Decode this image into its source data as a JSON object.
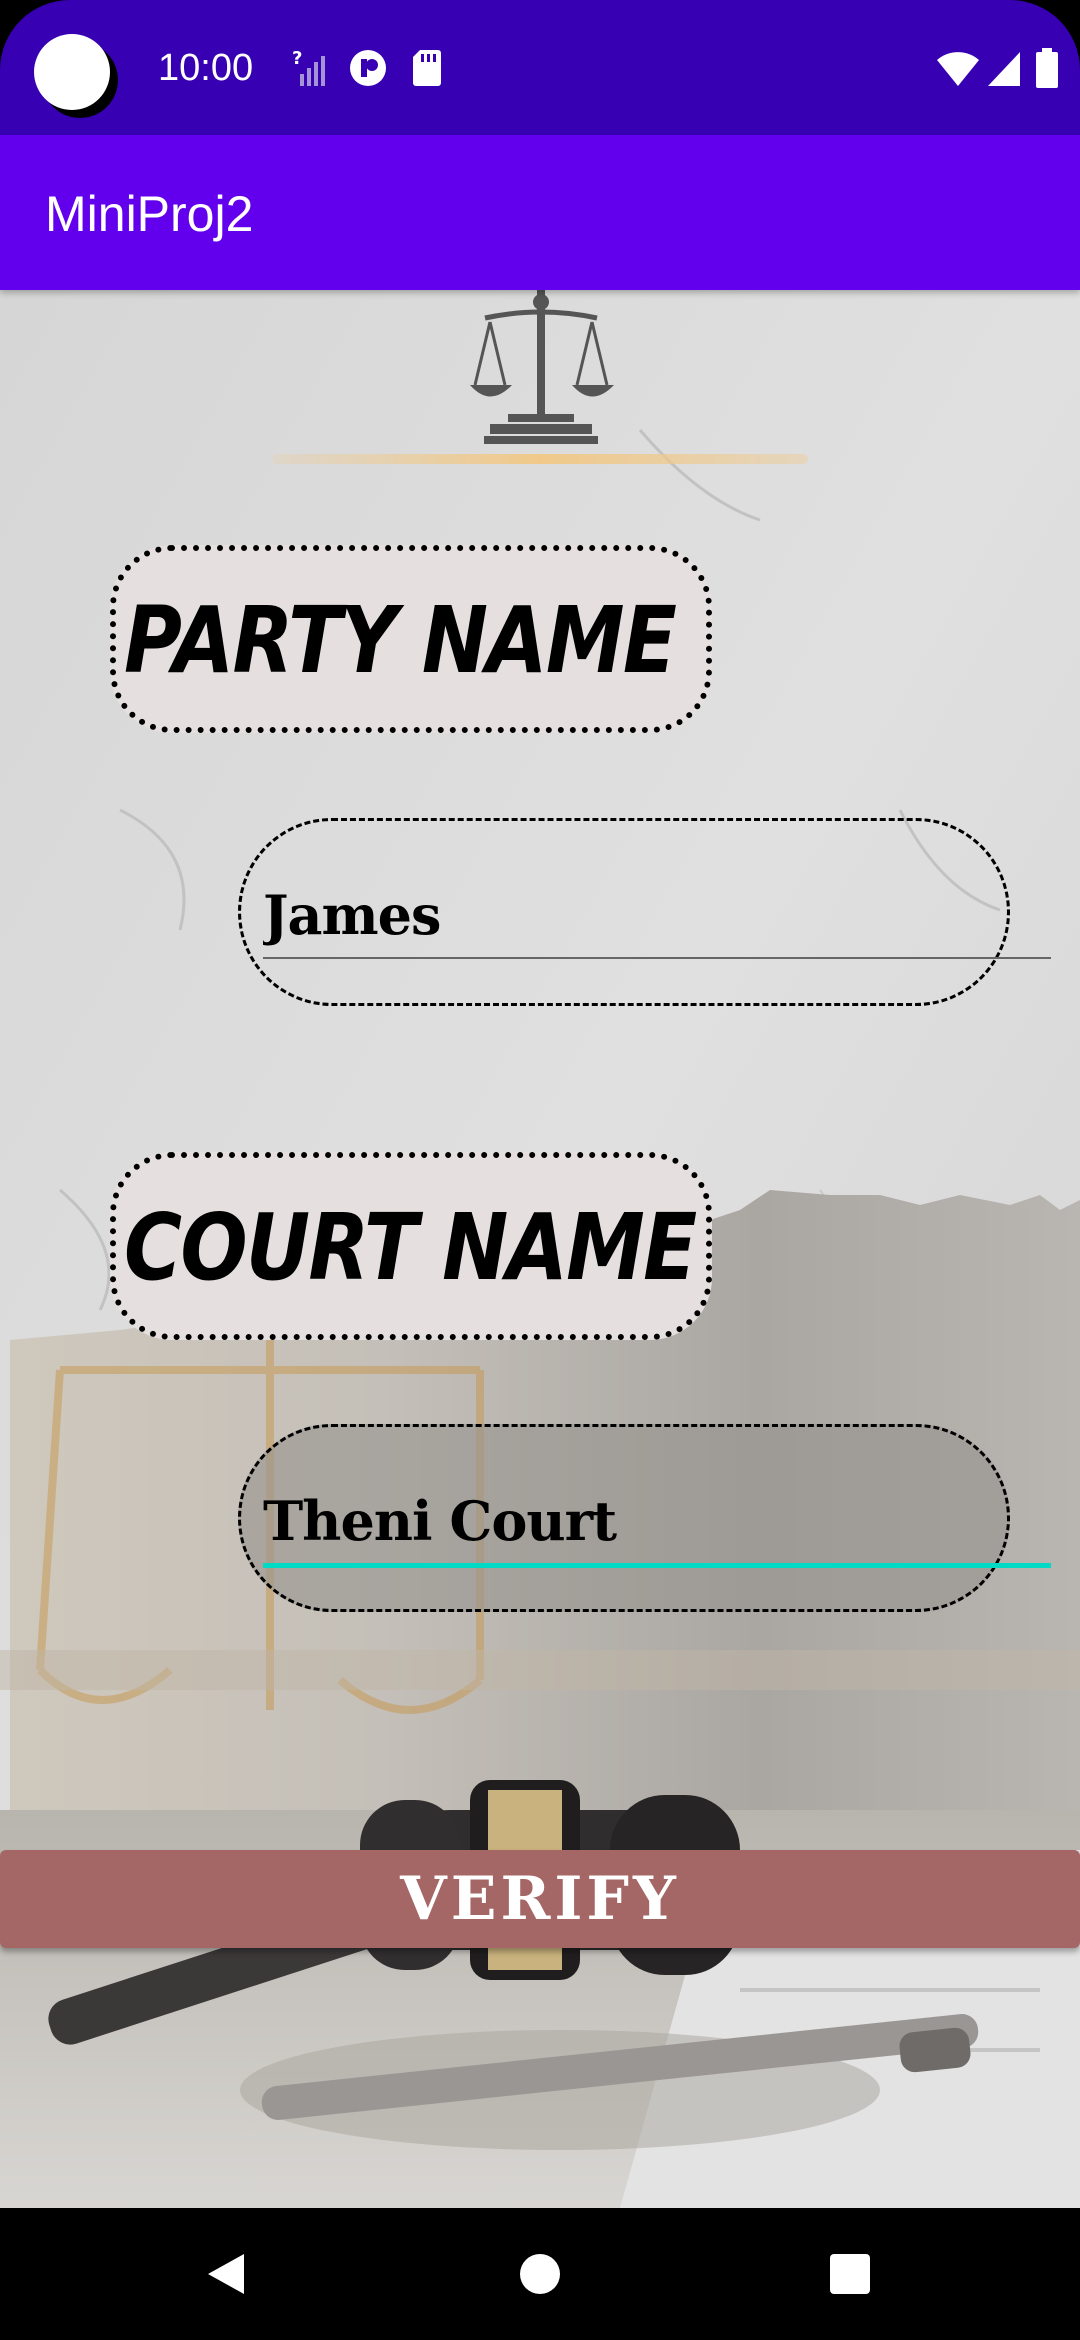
{
  "status_bar": {
    "time": "10:00",
    "icons_left": [
      "signal-unknown-icon",
      "vpn-icon",
      "sd-card-icon"
    ],
    "icons_right": [
      "wifi-icon",
      "cell-signal-icon",
      "battery-icon"
    ]
  },
  "app_bar": {
    "title": "MiniProj2"
  },
  "form": {
    "party_label": "PARTY NAME",
    "party_value": "James",
    "court_label": "COURT NAME",
    "court_value": "Theni Court",
    "verify_label": "VERIFY"
  },
  "colors": {
    "status_bar": "#3700b3",
    "app_bar": "#6200ee",
    "verify_button": "#a56666",
    "focus_accent": "#03dac5",
    "label_box": "#e6dfdf"
  },
  "navigation": {
    "items": [
      "back-icon",
      "home-icon",
      "recents-icon"
    ]
  }
}
